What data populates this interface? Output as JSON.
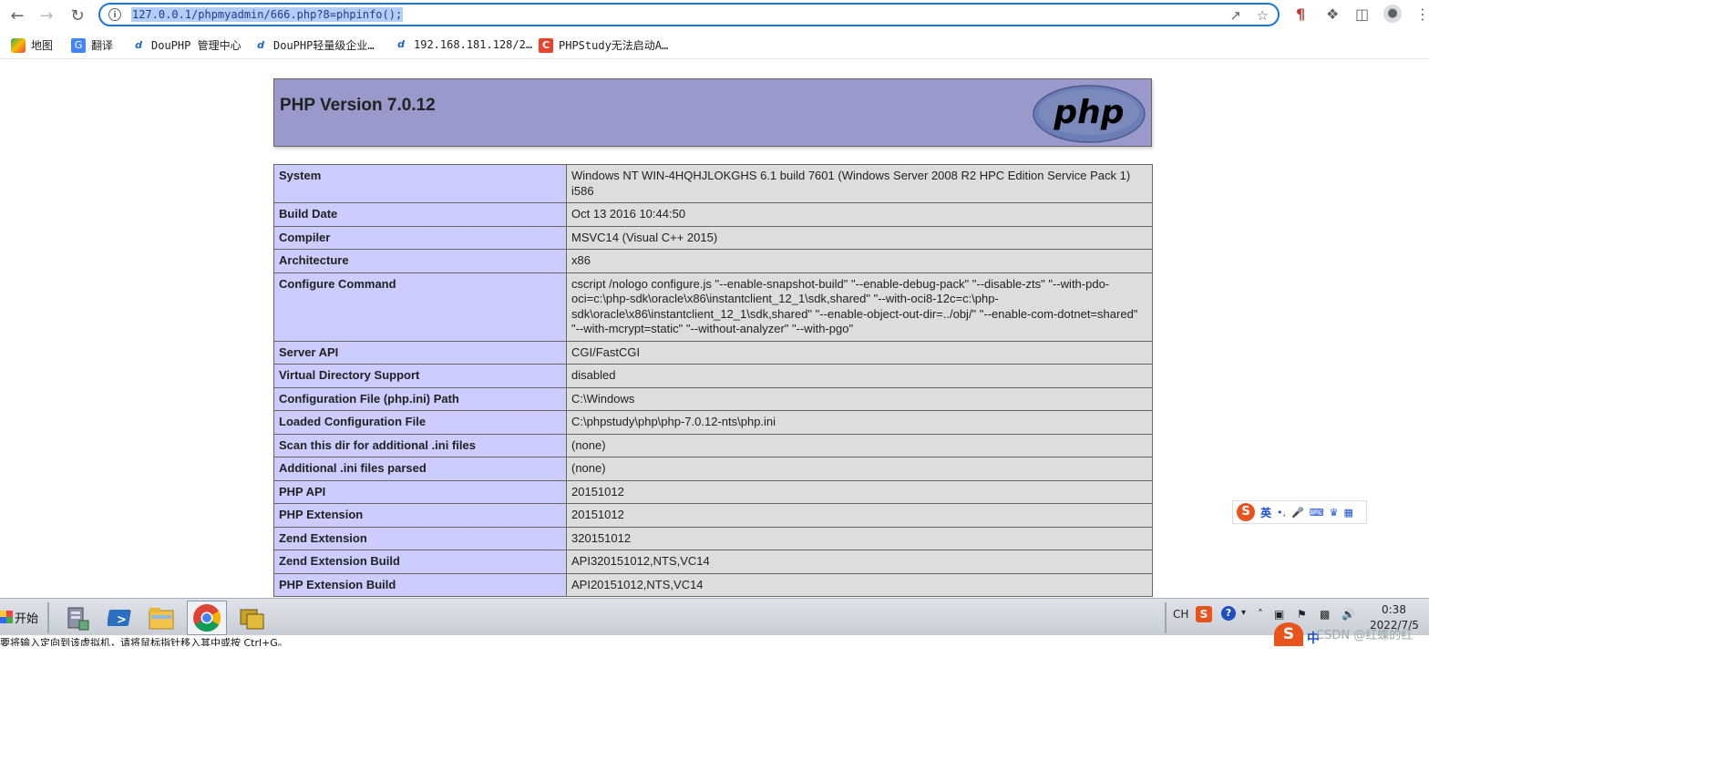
{
  "browser": {
    "url": "127.0.0.1/phpmyadmin/666.php?8=phpinfo();",
    "bookmarks": [
      {
        "label": "地图",
        "icon": "maps-icon"
      },
      {
        "label": "翻译",
        "icon": "translate-icon"
      },
      {
        "label": "DouPHP 管理中心",
        "icon": "douphp-icon"
      },
      {
        "label": "DouPHP轻量级企业…",
        "icon": "douphp-icon"
      },
      {
        "label": "192.168.181.128/2…",
        "icon": "douphp-icon"
      },
      {
        "label": "PHPStudy无法启动A…",
        "icon": "csdn-icon"
      }
    ]
  },
  "phpinfo": {
    "title": "PHP Version 7.0.12",
    "logo_text": "php",
    "rows": [
      {
        "key": "System",
        "value": "Windows NT WIN-4HQHJLOKGHS 6.1 build 7601 (Windows Server 2008 R2 HPC Edition Service Pack 1) i586"
      },
      {
        "key": "Build Date",
        "value": "Oct 13 2016 10:44:50"
      },
      {
        "key": "Compiler",
        "value": "MSVC14 (Visual C++ 2015)"
      },
      {
        "key": "Architecture",
        "value": "x86"
      },
      {
        "key": "Configure Command",
        "value": "cscript /nologo configure.js \"--enable-snapshot-build\" \"--enable-debug-pack\" \"--disable-zts\" \"--with-pdo-oci=c:\\php-sdk\\oracle\\x86\\instantclient_12_1\\sdk,shared\" \"--with-oci8-12c=c:\\php-sdk\\oracle\\x86\\instantclient_12_1\\sdk,shared\" \"--enable-object-out-dir=../obj/\" \"--enable-com-dotnet=shared\" \"--with-mcrypt=static\" \"--without-analyzer\" \"--with-pgo\""
      },
      {
        "key": "Server API",
        "value": "CGI/FastCGI"
      },
      {
        "key": "Virtual Directory Support",
        "value": "disabled"
      },
      {
        "key": "Configuration File (php.ini) Path",
        "value": "C:\\Windows"
      },
      {
        "key": "Loaded Configuration File",
        "value": "C:\\phpstudy\\php\\php-7.0.12-nts\\php.ini"
      },
      {
        "key": "Scan this dir for additional .ini files",
        "value": "(none)"
      },
      {
        "key": "Additional .ini files parsed",
        "value": "(none)"
      },
      {
        "key": "PHP API",
        "value": "20151012"
      },
      {
        "key": "PHP Extension",
        "value": "20151012"
      },
      {
        "key": "Zend Extension",
        "value": "320151012"
      },
      {
        "key": "Zend Extension Build",
        "value": "API320151012,NTS,VC14"
      },
      {
        "key": "PHP Extension Build",
        "value": "API20151012,NTS,VC14"
      }
    ]
  },
  "ime": {
    "mode": "英"
  },
  "taskbar": {
    "start_label": "开始",
    "lang": "CH",
    "time": "0:38",
    "date": "2022/7/5",
    "watermark": "CSDN @红蝶的红",
    "ime_mode": "中"
  },
  "status_text": "要将输入定向到该虚拟机，请将鼠标指针移入其中或按 Ctrl+G。",
  "colors": {
    "header_bg": "#9999cc",
    "key_bg": "#ccccff",
    "value_bg": "#dddddd",
    "omnibox_border": "#1a73e8"
  }
}
